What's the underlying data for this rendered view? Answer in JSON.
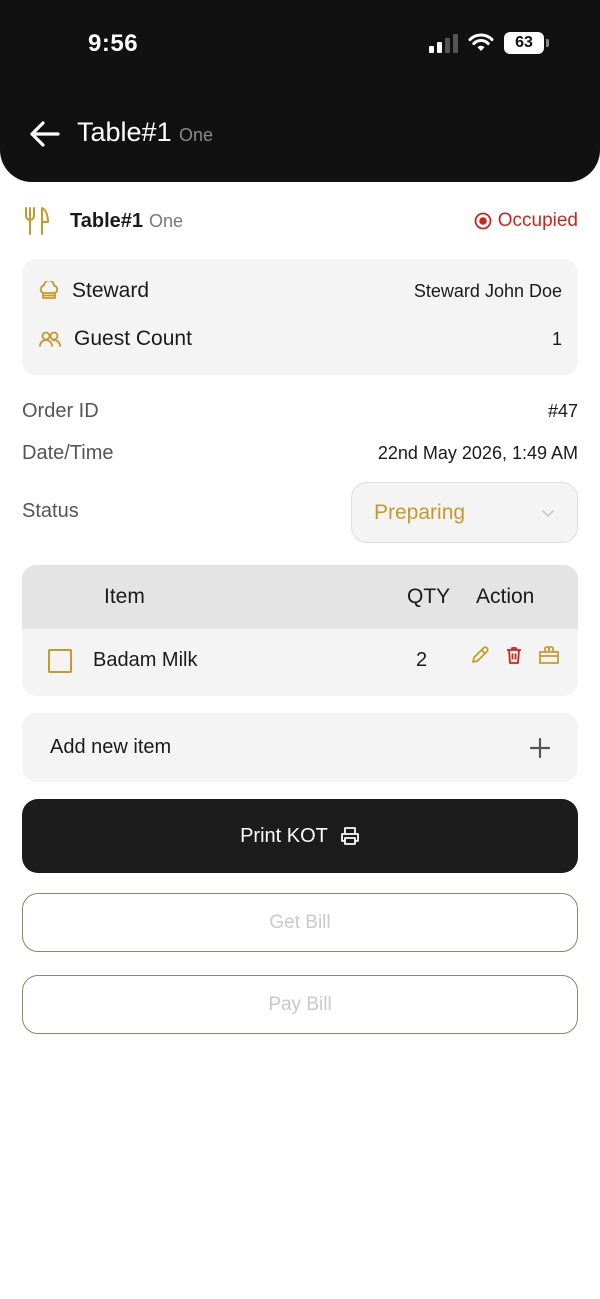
{
  "status_bar": {
    "time": "9:56",
    "battery": "63"
  },
  "header": {
    "title": "Table#1",
    "subtitle": "One"
  },
  "table_info": {
    "name": "Table#1",
    "sub": "One",
    "status": "Occupied"
  },
  "details_card": {
    "steward_label": "Steward",
    "steward_value": "Steward John Doe",
    "guest_label": "Guest Count",
    "guest_value": "1"
  },
  "order": {
    "id_label": "Order ID",
    "id_value": "#47",
    "datetime_label": "Date/Time",
    "datetime_value": "22nd May 2026, 1:49 AM",
    "status_label": "Status",
    "status_value": "Preparing"
  },
  "items_table": {
    "headers": {
      "item": "Item",
      "qty": "QTY",
      "action": "Action"
    },
    "rows": [
      {
        "name": "Badam Milk",
        "qty": "2"
      }
    ]
  },
  "add_item": {
    "label": "Add new item"
  },
  "buttons": {
    "print_kot": "Print KOT",
    "get_bill": "Get Bill",
    "pay_bill": "Pay Bill"
  },
  "colors": {
    "accent": "#c49a2c",
    "danger": "#c6281f",
    "dark": "#111111"
  }
}
